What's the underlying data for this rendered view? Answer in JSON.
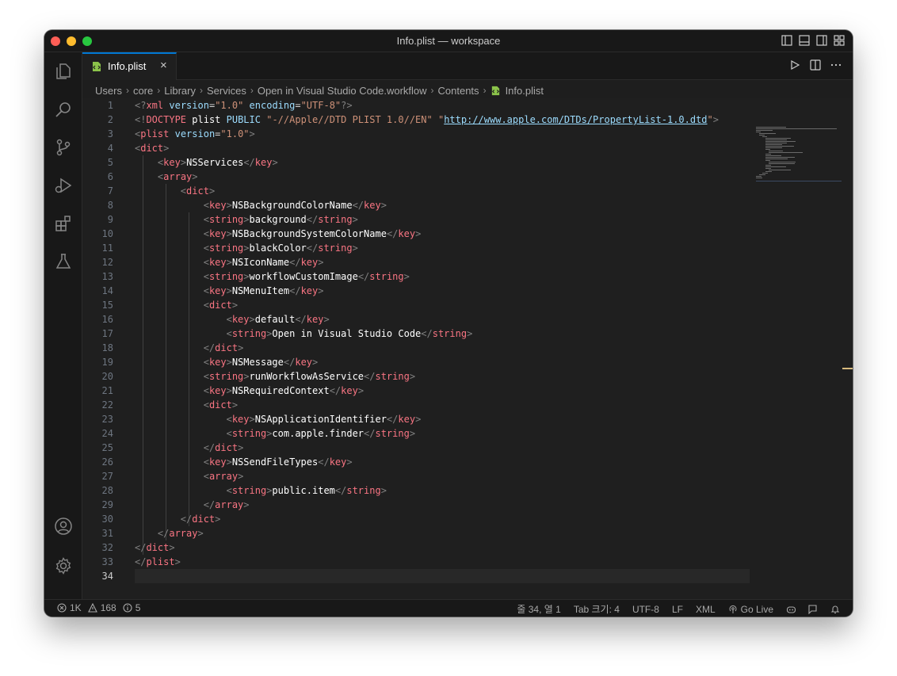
{
  "window": {
    "title": "Info.plist — workspace"
  },
  "tab": {
    "label": "Info.plist",
    "close": "×"
  },
  "breadcrumb": [
    "Users",
    "core",
    "Library",
    "Services",
    "Open in Visual Studio Code.workflow",
    "Contents",
    "Info.plist"
  ],
  "breadcrumb_separator": "›",
  "editor": {
    "active_line": 34,
    "line_numbers": [
      "1",
      "2",
      "3",
      "4",
      "5",
      "6",
      "7",
      "8",
      "9",
      "10",
      "11",
      "12",
      "13",
      "14",
      "15",
      "16",
      "17",
      "18",
      "19",
      "20",
      "21",
      "22",
      "23",
      "24",
      "25",
      "26",
      "27",
      "28",
      "29",
      "30",
      "31",
      "32",
      "33",
      "34"
    ]
  },
  "code": [
    "<?xml version=\"1.0\" encoding=\"UTF-8\"?>",
    "<!DOCTYPE plist PUBLIC \"-//Apple//DTD PLIST 1.0//EN\" \"http://www.apple.com/DTDs/PropertyList-1.0.dtd\">",
    "<plist version=\"1.0\">",
    "<dict>",
    "    <key>NSServices</key>",
    "    <array>",
    "        <dict>",
    "            <key>NSBackgroundColorName</key>",
    "            <string>background</string>",
    "            <key>NSBackgroundSystemColorName</key>",
    "            <string>blackColor</string>",
    "            <key>NSIconName</key>",
    "            <string>workflowCustomImage</string>",
    "            <key>NSMenuItem</key>",
    "            <dict>",
    "                <key>default</key>",
    "                <string>Open in Visual Studio Code</string>",
    "            </dict>",
    "            <key>NSMessage</key>",
    "            <string>runWorkflowAsService</string>",
    "            <key>NSRequiredContext</key>",
    "            <dict>",
    "                <key>NSApplicationIdentifier</key>",
    "                <string>com.apple.finder</string>",
    "            </dict>",
    "            <key>NSSendFileTypes</key>",
    "            <array>",
    "                <string>public.item</string>",
    "            </array>",
    "        </dict>",
    "    </array>",
    "</dict>",
    "</plist>",
    ""
  ],
  "statusbar": {
    "errors": "1K",
    "warnings": "168",
    "infos": "5",
    "position": "줄 34, 열 1",
    "indent": "Tab 크기: 4",
    "encoding": "UTF-8",
    "eol": "LF",
    "language": "XML",
    "go_live": "Go Live"
  },
  "icons": {
    "activity": [
      "files-icon",
      "search-icon",
      "source-control-icon",
      "run-debug-icon",
      "extensions-icon",
      "testing-icon"
    ],
    "activity_bottom": [
      "account-icon",
      "settings-gear-icon"
    ],
    "editor_actions": [
      "run-icon",
      "split-editor-icon",
      "more-actions-icon"
    ]
  },
  "colors": {
    "accent": "#0078d4",
    "tag": "#f97583",
    "string": "#ce9178",
    "attribute": "#9cdcfe",
    "text": "#ffffff"
  }
}
